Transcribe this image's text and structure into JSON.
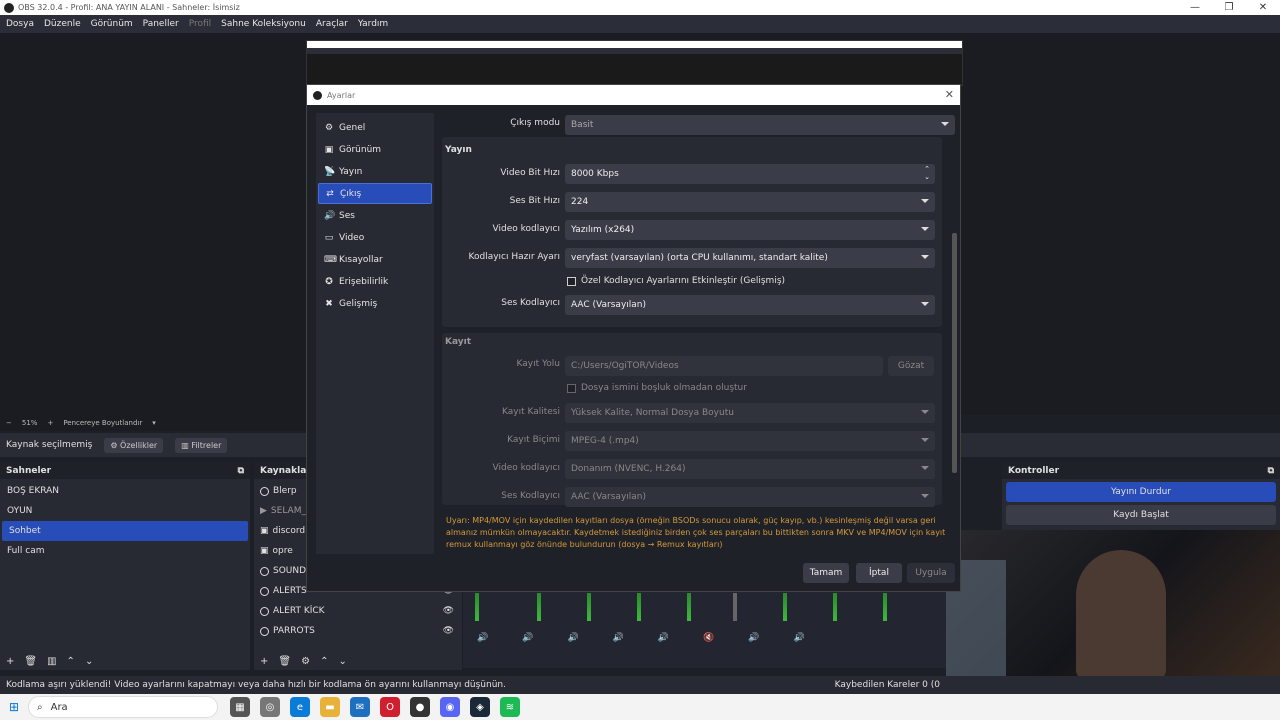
{
  "window": {
    "title": "OBS 32.0.4 - Profil: ANA YAYIN ALANI - Sahneler: İsimsiz",
    "min": "—",
    "max": "❐",
    "close": "✕"
  },
  "menu": {
    "items": [
      "Dosya",
      "Düzenle",
      "Görünüm",
      "Paneller",
      "Profil",
      "Sahne Koleksiyonu",
      "Araçlar",
      "Yardım"
    ]
  },
  "zoom": {
    "minus": "−",
    "level": "51%",
    "plus": "+",
    "fit_label": "Pencereye Boyutlandır"
  },
  "sourcebar": {
    "no_source": "Kaynak seçilmemiş",
    "properties": "Özellikler",
    "filters": "Filtreler"
  },
  "scenes": {
    "title": "Sahneler",
    "items": [
      "BOŞ EKRAN",
      "OYUN",
      "Sohbet",
      "Full cam"
    ],
    "active_index": 2
  },
  "sources": {
    "title": "Kaynaklar",
    "items": [
      "Blerp",
      "SELAM_",
      "discord",
      "opre",
      "SOUND",
      "ALERTS",
      "ALERT KİCK",
      "PARROTS"
    ]
  },
  "controls": {
    "title": "Kontroller",
    "stop_stream": "Yayını Durdur",
    "start_record": "Kaydı Başlat"
  },
  "status": {
    "message": "Kodlama aşırı yüklendi! Video ayarlarını kapatmayı veya daha hızlı bir kodlama ön ayarını kullanmayı düşünün.",
    "dropped": "Kaybedilen Kareler 0 (0"
  },
  "taskbar": {
    "search_placeholder": "Ara"
  },
  "settings": {
    "title": "Ayarlar",
    "nav": [
      {
        "label": "Genel",
        "icon": "⚙"
      },
      {
        "label": "Görünüm",
        "icon": "▣"
      },
      {
        "label": "Yayın",
        "icon": "📡"
      },
      {
        "label": "Çıkış",
        "icon": "⇄"
      },
      {
        "label": "Ses",
        "icon": "🔊"
      },
      {
        "label": "Video",
        "icon": "▭"
      },
      {
        "label": "Kısayollar",
        "icon": "⌨"
      },
      {
        "label": "Erişebilirlik",
        "icon": "✪"
      },
      {
        "label": "Gelişmiş",
        "icon": "✖"
      }
    ],
    "output_mode_label": "Çıkış modu",
    "output_mode_value": "Basit",
    "stream_section": "Yayın",
    "video_bitrate_label": "Video Bit Hızı",
    "video_bitrate_value": "8000 Kbps",
    "audio_bitrate_label": "Ses Bit Hızı",
    "audio_bitrate_value": "224",
    "video_encoder_label": "Video kodlayıcı",
    "video_encoder_value": "Yazılım (x264)",
    "encoder_preset_label": "Kodlayıcı Hazır Ayarı",
    "encoder_preset_value": "veryfast (varsayılan) (orta CPU kullanımı, standart kalite)",
    "custom_encoder_check": "Özel Kodlayıcı Ayarlarını Etkinleştir (Gelişmiş)",
    "audio_encoder_label": "Ses Kodlayıcı",
    "audio_encoder_value": "AAC (Varsayılan)",
    "record_section": "Kayıt",
    "record_path_label": "Kayıt Yolu",
    "record_path_value": "C:/Users/OgiTOR/Videos",
    "browse": "Gözat",
    "no_space_check": "Dosya ismini boşluk olmadan oluştur",
    "record_quality_label": "Kayıt Kalitesi",
    "record_quality_value": "Yüksek Kalite, Normal Dosya Boyutu",
    "record_format_label": "Kayıt Biçimi",
    "record_format_value": "MPEG-4 (.mp4)",
    "rec_video_encoder_label": "Video kodlayıcı",
    "rec_video_encoder_value": "Donanım (NVENC, H.264)",
    "rec_audio_encoder_label": "Ses Kodlayıcı",
    "rec_audio_encoder_value": "AAC (Varsayılan)",
    "warning": "Uyarı: MP4/MOV için kaydedilen kayıtları dosya (örneğin BSODs sonucu olarak, güç kayıp, vb.) kesinleşmiş değil varsa geri almanız mümkün olmayacaktır. Kaydetmek istediğiniz birden çok ses parçaları bu bittikten sonra MKV ve MP4/MOV için kayıt remux kullanmayı göz önünde bulundurun (dosya → Remux kayıtları)",
    "ok": "Tamam",
    "cancel": "İptal",
    "apply": "Uygula"
  },
  "colors": {
    "accent": "#284cb8",
    "bg": "#1d1f26",
    "warning": "#d49a3a"
  }
}
